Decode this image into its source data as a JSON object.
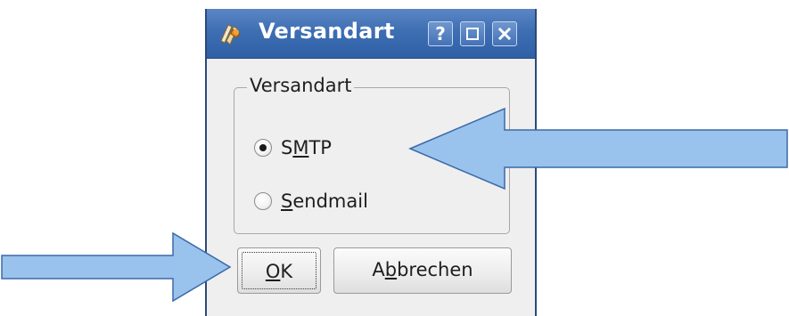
{
  "dialog": {
    "title": "Versandart",
    "titlebar_buttons": {
      "help": "?",
      "maximize": "maximize-icon",
      "close": "close-icon"
    }
  },
  "group": {
    "title": "Versandart",
    "options": [
      {
        "label_pre": "S",
        "mnemonic": "M",
        "label_post": "TP",
        "selected": true
      },
      {
        "label_pre": "",
        "mnemonic": "S",
        "label_post": "endmail",
        "selected": false
      }
    ]
  },
  "buttons": {
    "ok": {
      "mnemonic": "O",
      "rest": "K",
      "focused": true
    },
    "cancel": {
      "pre": "A",
      "mnemonic": "b",
      "post": "brechen"
    }
  },
  "annotations": {
    "arrow_color": "#99c2ed",
    "arrow_stroke": "#3a6aa8",
    "arrows": [
      "points-to-smtp-option",
      "points-to-ok-button"
    ]
  },
  "colors": {
    "titlebar": "#3e6fb3",
    "window_bg": "#efefef"
  }
}
